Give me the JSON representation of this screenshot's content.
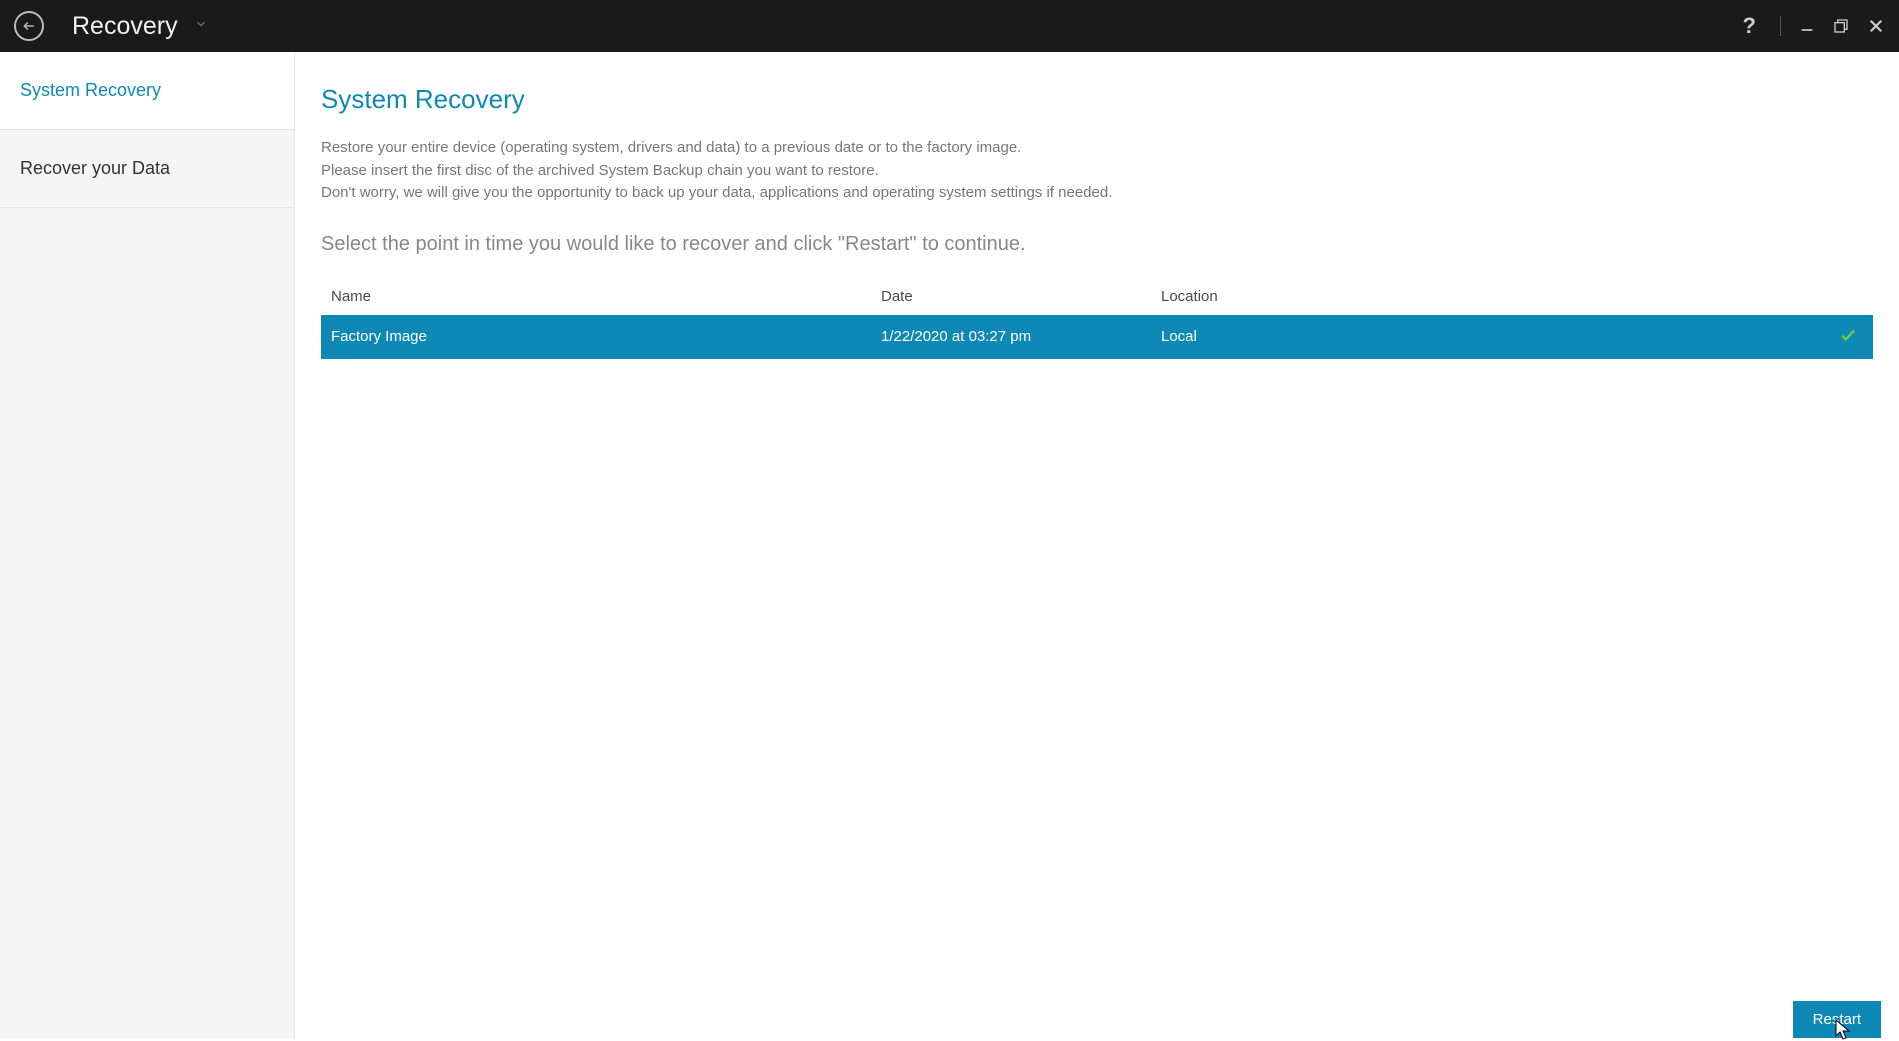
{
  "titlebar": {
    "title": "Recovery"
  },
  "sidebar": {
    "items": [
      {
        "label": "System Recovery",
        "active": true
      },
      {
        "label": "Recover your Data",
        "active": false
      }
    ]
  },
  "main": {
    "title": "System Recovery",
    "desc_line1": "Restore your entire device (operating system, drivers and data) to a previous date or to the factory image.",
    "desc_line2": "Please insert the first disc of the archived System Backup chain you want to restore.",
    "desc_line3": "Don't worry, we will give you the opportunity to back up your data, applications and operating system settings if needed.",
    "select_prompt": "Select the point in time you would like to recover and click \"Restart\" to continue.",
    "table": {
      "headers": {
        "name": "Name",
        "date": "Date",
        "location": "Location"
      },
      "rows": [
        {
          "name": "Factory Image",
          "date": "1/22/2020 at 03:27 pm",
          "location": "Local",
          "selected": true
        }
      ]
    },
    "footer_button": "Restart"
  }
}
